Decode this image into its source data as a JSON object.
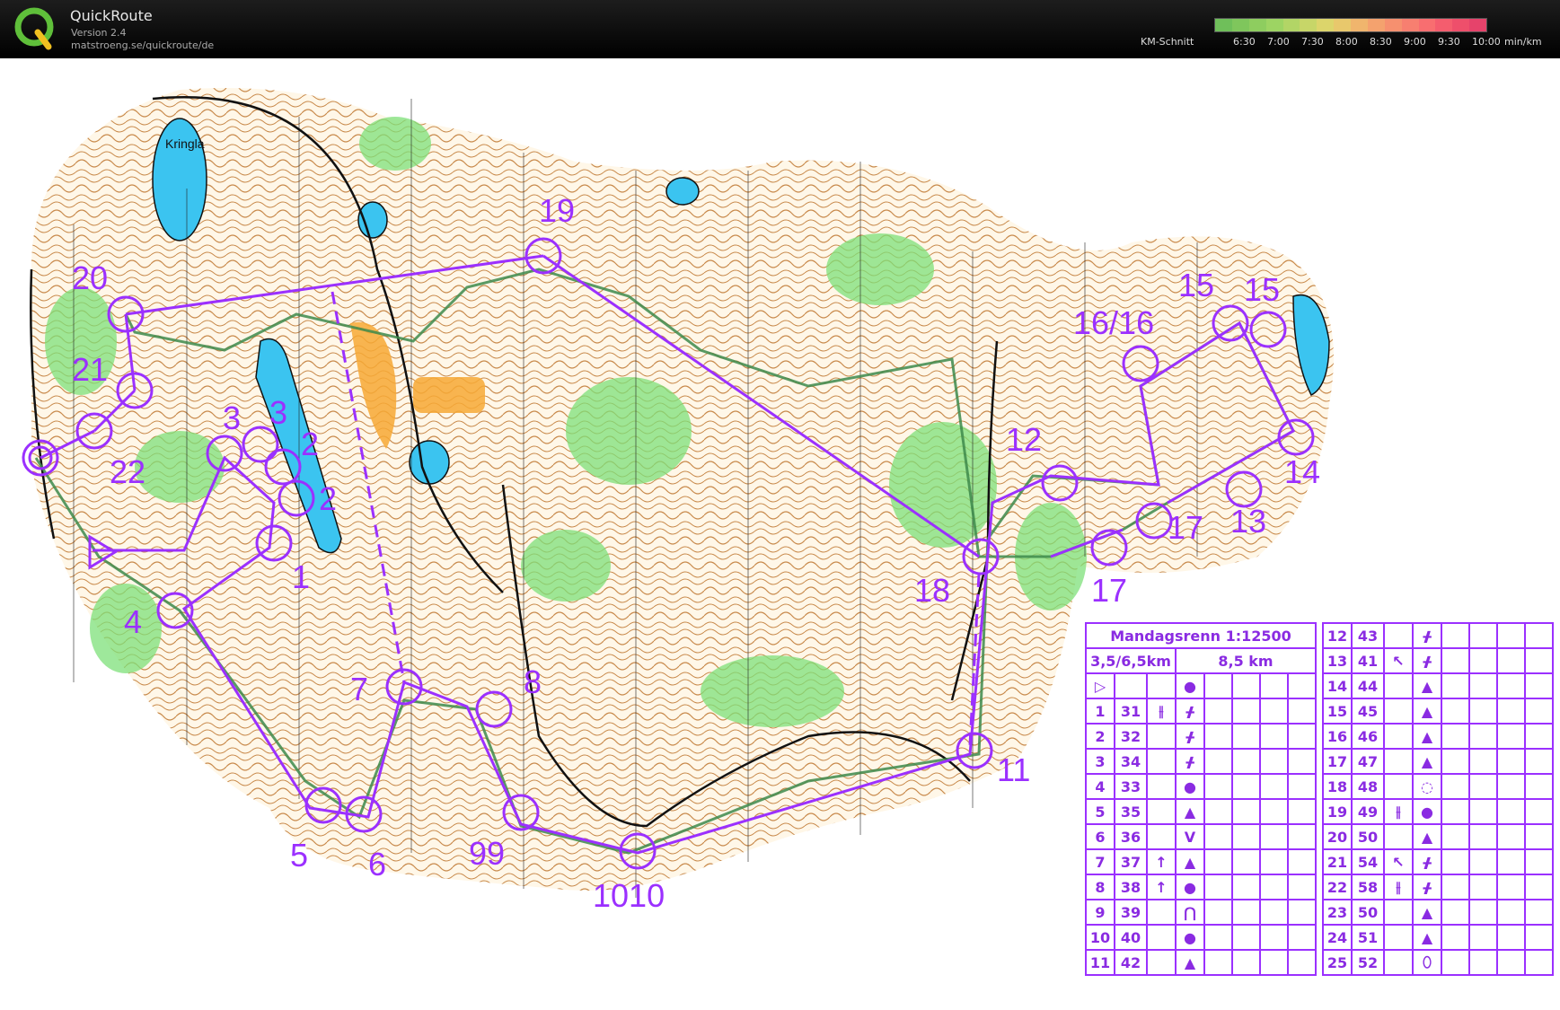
{
  "app": {
    "title": "QuickRoute",
    "version": "Version 2.4",
    "url": "matstroeng.se/quickroute/de",
    "logo_letter": "Q"
  },
  "legend": {
    "label": "KM-Schnitt",
    "ticks": [
      "6:30",
      "7:00",
      "7:30",
      "8:00",
      "8:30",
      "9:00",
      "9:30",
      "10:00",
      "min/km"
    ],
    "colors": [
      "#6fbf5a",
      "#7fc65c",
      "#8ecd5f",
      "#9dd463",
      "#b2d566",
      "#c7d668",
      "#dcd56b",
      "#e8c86c",
      "#f0b56d",
      "#f4a26e",
      "#f6906f",
      "#f77f70",
      "#f86e70",
      "#f45d6e",
      "#ee4f6b",
      "#e6436b"
    ]
  },
  "map": {
    "lake_label": "Kringla",
    "course_color": "#9b30ff",
    "control_labels": [
      {
        "id": "c19",
        "text": "19"
      },
      {
        "id": "c20",
        "text": "20"
      },
      {
        "id": "c21",
        "text": "21"
      },
      {
        "id": "c22",
        "text": "22"
      },
      {
        "id": "c3a",
        "text": "3"
      },
      {
        "id": "c3b",
        "text": "3"
      },
      {
        "id": "c2a",
        "text": "2"
      },
      {
        "id": "c2b",
        "text": "2"
      },
      {
        "id": "c1",
        "text": "1"
      },
      {
        "id": "c4",
        "text": "4"
      },
      {
        "id": "c5",
        "text": "5"
      },
      {
        "id": "c6",
        "text": "6"
      },
      {
        "id": "c7",
        "text": "7"
      },
      {
        "id": "c8",
        "text": "8"
      },
      {
        "id": "c99",
        "text": "99"
      },
      {
        "id": "c1010",
        "text": "1010"
      },
      {
        "id": "c11",
        "text": "11"
      },
      {
        "id": "c12",
        "text": "12"
      },
      {
        "id": "c13",
        "text": "13"
      },
      {
        "id": "c14",
        "text": "14"
      },
      {
        "id": "c15a",
        "text": "15"
      },
      {
        "id": "c15b",
        "text": "15"
      },
      {
        "id": "c1616",
        "text": "16/16"
      },
      {
        "id": "c17a",
        "text": "17"
      },
      {
        "id": "c17b",
        "text": "17"
      },
      {
        "id": "c18",
        "text": "18"
      }
    ]
  },
  "description": {
    "title": "Mandagsrenn 1:12500",
    "length_short": "3,5/6,5km",
    "length_long": "8,5 km",
    "start_row": {
      "num": "",
      "code": "",
      "sym1": "",
      "sym2": "●"
    },
    "rows_left": [
      {
        "num": "1",
        "code": "31",
        "sym1": "⫲",
        "sym2": "ᚋ"
      },
      {
        "num": "2",
        "code": "32",
        "sym1": "",
        "sym2": "ᚋ"
      },
      {
        "num": "3",
        "code": "34",
        "sym1": "",
        "sym2": "ᚋ"
      },
      {
        "num": "4",
        "code": "33",
        "sym1": "",
        "sym2": "●"
      },
      {
        "num": "5",
        "code": "35",
        "sym1": "",
        "sym2": "▲"
      },
      {
        "num": "6",
        "code": "36",
        "sym1": "",
        "sym2": "V"
      },
      {
        "num": "7",
        "code": "37",
        "sym1": "↑",
        "sym2": "▲"
      },
      {
        "num": "8",
        "code": "38",
        "sym1": "↑",
        "sym2": "●"
      },
      {
        "num": "9",
        "code": "39",
        "sym1": "",
        "sym2": "⋂"
      },
      {
        "num": "10",
        "code": "40",
        "sym1": "",
        "sym2": "●"
      },
      {
        "num": "11",
        "code": "42",
        "sym1": "",
        "sym2": "▲"
      }
    ],
    "rows_right": [
      {
        "num": "12",
        "code": "43",
        "sym1": "",
        "sym2": "ᚋ"
      },
      {
        "num": "13",
        "code": "41",
        "sym1": "↖",
        "sym2": "ᚋ"
      },
      {
        "num": "14",
        "code": "44",
        "sym1": "",
        "sym2": "▲"
      },
      {
        "num": "15",
        "code": "45",
        "sym1": "",
        "sym2": "▲"
      },
      {
        "num": "16",
        "code": "46",
        "sym1": "",
        "sym2": "▲"
      },
      {
        "num": "17",
        "code": "47",
        "sym1": "",
        "sym2": "▲"
      },
      {
        "num": "18",
        "code": "48",
        "sym1": "",
        "sym2": "◌"
      },
      {
        "num": "19",
        "code": "49",
        "sym1": "⫲",
        "sym2": "●"
      },
      {
        "num": "20",
        "code": "50",
        "sym1": "",
        "sym2": "▲"
      },
      {
        "num": "21",
        "code": "54",
        "sym1": "↖",
        "sym2": "ᚋ"
      },
      {
        "num": "22",
        "code": "58",
        "sym1": "⫲",
        "sym2": "ᚋ"
      },
      {
        "num": "23",
        "code": "50",
        "sym1": "",
        "sym2": "▲"
      },
      {
        "num": "24",
        "code": "51",
        "sym1": "",
        "sym2": "▲"
      },
      {
        "num": "25",
        "code": "52",
        "sym1": "",
        "sym2": "⬯"
      }
    ]
  }
}
